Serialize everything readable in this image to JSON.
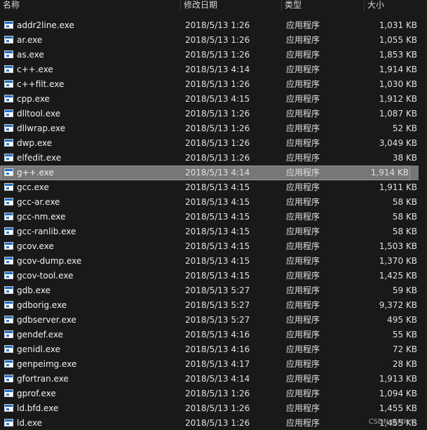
{
  "columns": {
    "name": "名称",
    "date": "修改日期",
    "type": "类型",
    "size": "大小"
  },
  "files": [
    {
      "name": "addr2line.exe",
      "date": "2018/5/13 1:26",
      "type": "应用程序",
      "size": "1,031 KB"
    },
    {
      "name": "ar.exe",
      "date": "2018/5/13 1:26",
      "type": "应用程序",
      "size": "1,055 KB"
    },
    {
      "name": "as.exe",
      "date": "2018/5/13 1:26",
      "type": "应用程序",
      "size": "1,853 KB"
    },
    {
      "name": "c++.exe",
      "date": "2018/5/13 4:14",
      "type": "应用程序",
      "size": "1,914 KB"
    },
    {
      "name": "c++filt.exe",
      "date": "2018/5/13 1:26",
      "type": "应用程序",
      "size": "1,030 KB"
    },
    {
      "name": "cpp.exe",
      "date": "2018/5/13 4:15",
      "type": "应用程序",
      "size": "1,912 KB"
    },
    {
      "name": "dlltool.exe",
      "date": "2018/5/13 1:26",
      "type": "应用程序",
      "size": "1,087 KB"
    },
    {
      "name": "dllwrap.exe",
      "date": "2018/5/13 1:26",
      "type": "应用程序",
      "size": "52 KB"
    },
    {
      "name": "dwp.exe",
      "date": "2018/5/13 1:26",
      "type": "应用程序",
      "size": "3,049 KB"
    },
    {
      "name": "elfedit.exe",
      "date": "2018/5/13 1:26",
      "type": "应用程序",
      "size": "38 KB"
    },
    {
      "name": "g++.exe",
      "date": "2018/5/13 4:14",
      "type": "应用程序",
      "size": "1,914 KB"
    },
    {
      "name": "gcc.exe",
      "date": "2018/5/13 4:15",
      "type": "应用程序",
      "size": "1,911 KB"
    },
    {
      "name": "gcc-ar.exe",
      "date": "2018/5/13 4:15",
      "type": "应用程序",
      "size": "58 KB"
    },
    {
      "name": "gcc-nm.exe",
      "date": "2018/5/13 4:15",
      "type": "应用程序",
      "size": "58 KB"
    },
    {
      "name": "gcc-ranlib.exe",
      "date": "2018/5/13 4:15",
      "type": "应用程序",
      "size": "58 KB"
    },
    {
      "name": "gcov.exe",
      "date": "2018/5/13 4:15",
      "type": "应用程序",
      "size": "1,503 KB"
    },
    {
      "name": "gcov-dump.exe",
      "date": "2018/5/13 4:15",
      "type": "应用程序",
      "size": "1,370 KB"
    },
    {
      "name": "gcov-tool.exe",
      "date": "2018/5/13 4:15",
      "type": "应用程序",
      "size": "1,425 KB"
    },
    {
      "name": "gdb.exe",
      "date": "2018/5/13 5:27",
      "type": "应用程序",
      "size": "59 KB"
    },
    {
      "name": "gdborig.exe",
      "date": "2018/5/13 5:27",
      "type": "应用程序",
      "size": "9,372 KB"
    },
    {
      "name": "gdbserver.exe",
      "date": "2018/5/13 5:27",
      "type": "应用程序",
      "size": "495 KB"
    },
    {
      "name": "gendef.exe",
      "date": "2018/5/13 4:16",
      "type": "应用程序",
      "size": "55 KB"
    },
    {
      "name": "genidl.exe",
      "date": "2018/5/13 4:16",
      "type": "应用程序",
      "size": "72 KB"
    },
    {
      "name": "genpeimg.exe",
      "date": "2018/5/13 4:17",
      "type": "应用程序",
      "size": "28 KB"
    },
    {
      "name": "gfortran.exe",
      "date": "2018/5/13 4:14",
      "type": "应用程序",
      "size": "1,913 KB"
    },
    {
      "name": "gprof.exe",
      "date": "2018/5/13 1:26",
      "type": "应用程序",
      "size": "1,094 KB"
    },
    {
      "name": "ld.bfd.exe",
      "date": "2018/5/13 1:26",
      "type": "应用程序",
      "size": "1,455 KB"
    },
    {
      "name": "ld.exe",
      "date": "2018/5/13 1:26",
      "type": "应用程序",
      "size": "1,455 KB"
    }
  ],
  "selected_file": "g++.exe",
  "watermark": "CSDN @MH.K",
  "icon": "application-exe-icon",
  "colors": {
    "background": "#191919",
    "selected_row": "#777777",
    "icon_accent": "#1f6fc9"
  }
}
